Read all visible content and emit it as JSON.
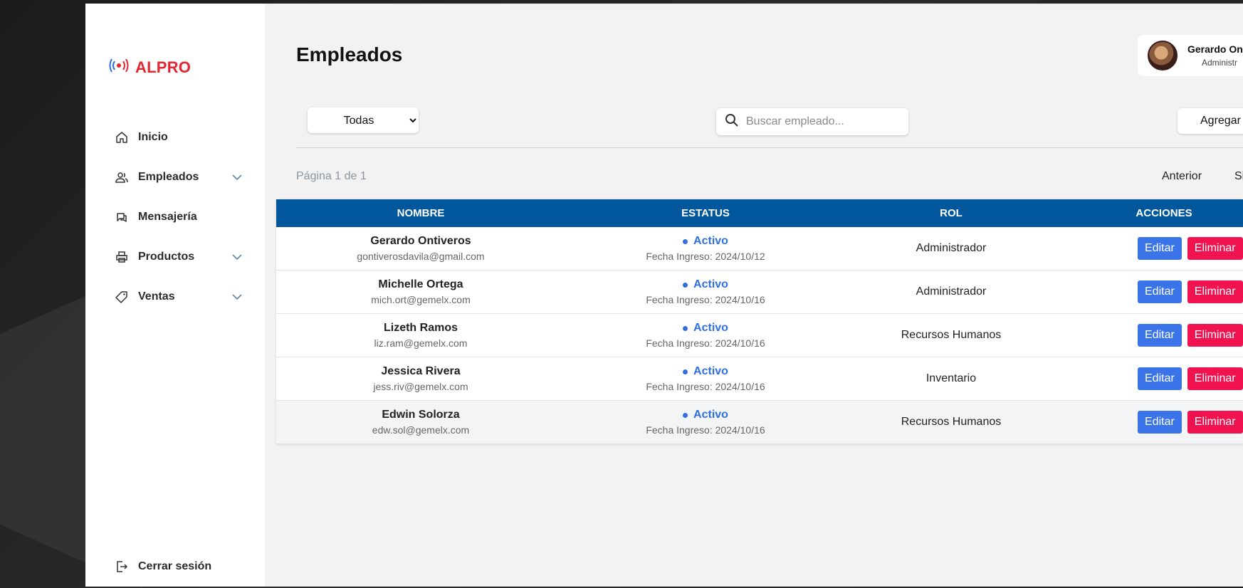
{
  "app": {
    "brand": "ALPRO"
  },
  "sidebar": {
    "items": [
      {
        "label": "Inicio",
        "icon": "home-icon",
        "has_submenu": false
      },
      {
        "label": "Empleados",
        "icon": "users-icon",
        "has_submenu": true
      },
      {
        "label": "Mensajería",
        "icon": "chat-icon",
        "has_submenu": false
      },
      {
        "label": "Productos",
        "icon": "printer-icon",
        "has_submenu": true
      },
      {
        "label": "Ventas",
        "icon": "tag-icon",
        "has_submenu": true
      }
    ],
    "logout_label": "Cerrar sesión"
  },
  "header": {
    "title": "Empleados",
    "user": {
      "name": "Gerardo On",
      "role": "Administr"
    }
  },
  "toolbar": {
    "filter_selected": "Todas",
    "search_placeholder": "Buscar empleado...",
    "add_label": "Agregar"
  },
  "pagination": {
    "info": "Página 1 de 1",
    "prev_label": "Anterior",
    "next_label": "Si"
  },
  "table": {
    "headers": [
      "NOMBRE",
      "ESTATUS",
      "ROL",
      "ACCIONES"
    ],
    "rows": [
      {
        "name": "Gerardo Ontiveros",
        "email": "gontiverosdavila@gmail.com",
        "status": "Activo",
        "date": "Fecha Ingreso: 2024/10/12",
        "role": "Administrador"
      },
      {
        "name": "Michelle Ortega",
        "email": "mich.ort@gemelx.com",
        "status": "Activo",
        "date": "Fecha Ingreso: 2024/10/16",
        "role": "Administrador"
      },
      {
        "name": "Lizeth Ramos",
        "email": "liz.ram@gemelx.com",
        "status": "Activo",
        "date": "Fecha Ingreso: 2024/10/16",
        "role": "Recursos Humanos"
      },
      {
        "name": "Jessica Rivera",
        "email": "jess.riv@gemelx.com",
        "status": "Activo",
        "date": "Fecha Ingreso: 2024/10/16",
        "role": "Inventario"
      },
      {
        "name": "Edwin Solorza",
        "email": "edw.sol@gemelx.com",
        "status": "Activo",
        "date": "Fecha Ingreso: 2024/10/16",
        "role": "Recursos Humanos"
      }
    ],
    "edit_label": "Editar",
    "delete_label": "Eliminar"
  },
  "colors": {
    "brand": "#e3262f",
    "header_bg": "#01579b",
    "status": "#2f6fe0",
    "edit": "#3b74e8",
    "delete": "#f0134f"
  }
}
